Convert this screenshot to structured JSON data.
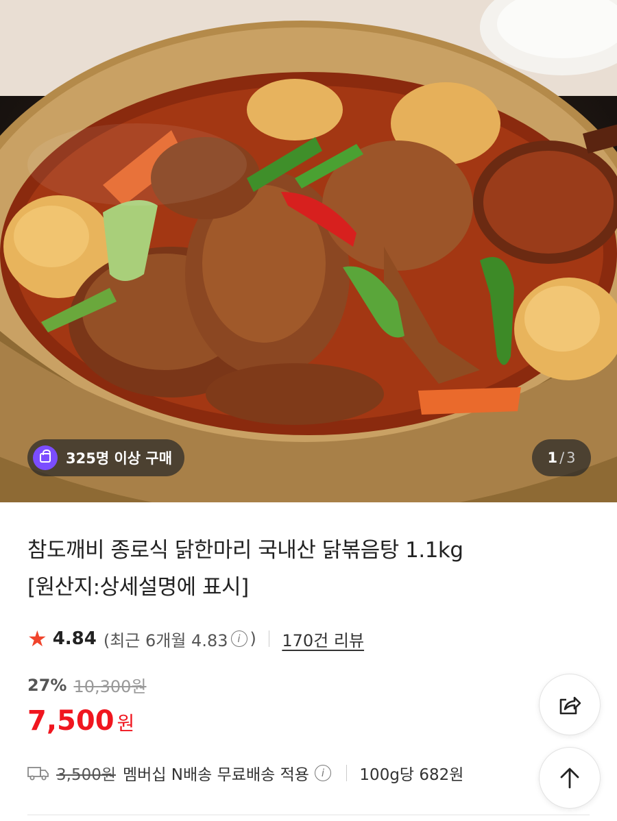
{
  "hero": {
    "purchase_badge": "325명 이상 구매",
    "pager": {
      "current": "1",
      "separator": "/",
      "total": "3"
    }
  },
  "product": {
    "title_line1": "참도깨비 종로식 닭한마리 국내산 닭볶음탕 1.1kg",
    "title_line2": "[원산지:상세설명에 표시]"
  },
  "rating": {
    "score": "4.84",
    "recent_prefix": "(최근 6개월 4.83",
    "recent_suffix": ")",
    "info_symbol": "i",
    "review_link": "170건 리뷰"
  },
  "price": {
    "discount_rate": "27%",
    "original_price": "10,300원",
    "sale_price": "7,500",
    "sale_unit": "원"
  },
  "delivery": {
    "shipping_original": "3,500원",
    "shipping_text": "멤버십 N배송 무료배송 적용",
    "per_unit_price": "100g당 682원"
  },
  "colors": {
    "accent_red": "#f0161f",
    "star": "#f0442c",
    "badge_purple": "#7b4dff"
  },
  "icons": [
    "purchase-bag-icon",
    "star-icon",
    "info-icon",
    "truck-icon",
    "share-icon",
    "arrow-up-icon"
  ]
}
